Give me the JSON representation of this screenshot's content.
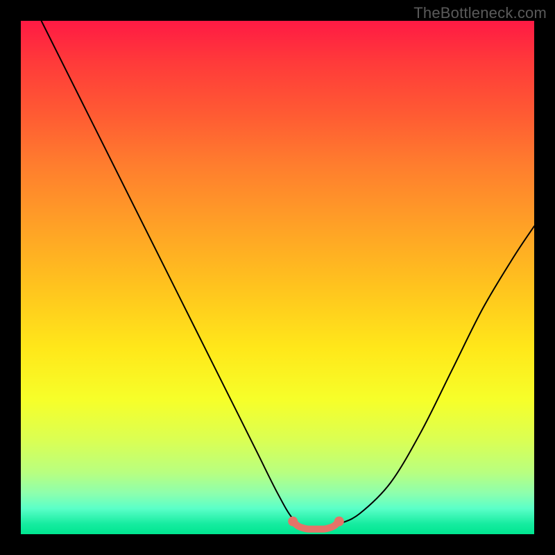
{
  "watermark": "TheBottleneck.com",
  "chart_data": {
    "type": "line",
    "title": "",
    "xlabel": "",
    "ylabel": "",
    "xlim": [
      0,
      100
    ],
    "ylim": [
      0,
      100
    ],
    "grid": false,
    "legend": false,
    "series": [
      {
        "name": "bottleneck-curve",
        "color": "#000000",
        "x": [
          4,
          10,
          16,
          22,
          28,
          34,
          40,
          46,
          50,
          53,
          56,
          59,
          62,
          66,
          72,
          78,
          84,
          90,
          96,
          100
        ],
        "y": [
          100,
          88,
          76,
          64,
          52,
          40,
          28,
          16,
          8,
          3,
          1,
          1,
          2,
          4,
          10,
          20,
          32,
          44,
          54,
          60
        ]
      },
      {
        "name": "flat-region-marker",
        "color": "#e57368",
        "x": [
          53,
          54,
          55,
          56,
          57,
          58,
          59,
          60,
          61,
          62
        ],
        "y": [
          2.5,
          1.6,
          1.2,
          1.0,
          1.0,
          1.0,
          1.0,
          1.2,
          1.6,
          2.5
        ]
      }
    ],
    "annotations": []
  }
}
